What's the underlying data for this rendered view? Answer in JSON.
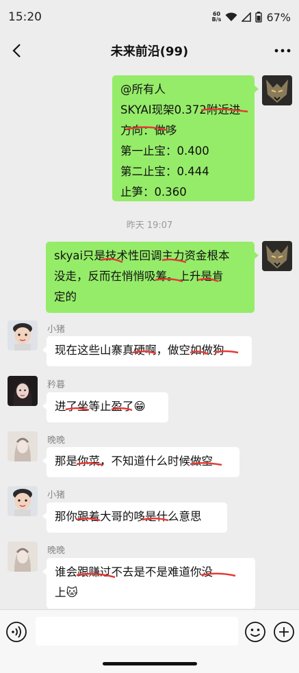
{
  "status": {
    "time": "15:20",
    "net_speed_top": "60",
    "net_speed_bottom": "B/s",
    "battery": "67%"
  },
  "header": {
    "title": "未来前沿(99)"
  },
  "messages": [
    {
      "lines": [
        "@所有人",
        "SKYAI现架0.372附近进",
        "方向：做哆",
        "第一止宝：0.400",
        "第二止宝：0.444",
        "止笋：0.360"
      ]
    },
    {
      "time": "昨天 19:07"
    },
    {
      "lines": [
        "skyai只是技术性回调主力资金根本",
        "没走，反而在悄悄吸筹。上升是肯",
        "定的"
      ]
    },
    {
      "sender": "小猪",
      "lines": [
        "现在这些山寨真硬啊，做空如做狗"
      ]
    },
    {
      "sender": "矜暮",
      "lines": [
        "进了坐等止盈了😁"
      ]
    },
    {
      "sender": "晚晚",
      "lines": [
        "那是你菜，不知道什么时候做空"
      ]
    },
    {
      "sender": "小猪",
      "lines": [
        "那你跟着大哥的哆是什么意思"
      ]
    },
    {
      "sender": "晚晚",
      "lines": [
        "谁会跟赚过不去是不是难道你没",
        "上🐱"
      ]
    }
  ],
  "icons": {
    "back": "chevron-left-icon",
    "more": "more-dots-icon",
    "voice": "voice-icon",
    "emoji": "emoji-icon",
    "plus": "plus-icon"
  },
  "colors": {
    "my_bubble": "#95ec69",
    "their_bubble": "#ffffff",
    "background": "#ededed",
    "redaction": "#e53935"
  }
}
